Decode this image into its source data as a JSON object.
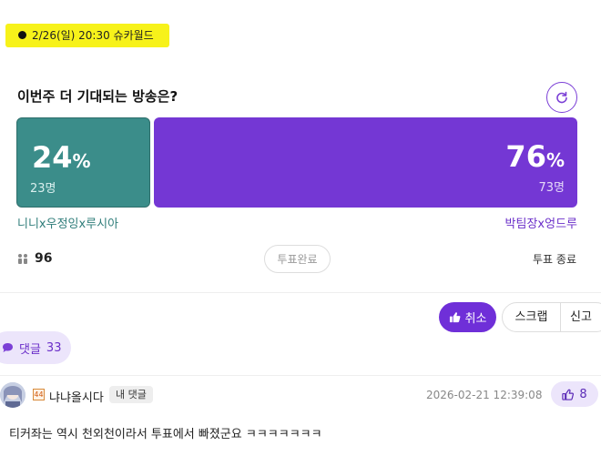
{
  "schedule": {
    "text": "2/26(일) 20:30 슈카월드"
  },
  "poll": {
    "question": "이번주 더 기대되는 방송은?",
    "options": [
      {
        "percent": "24",
        "unit": "%",
        "count": "23명",
        "name": "니니x우정잉x루시아",
        "color": "#3b8d8a"
      },
      {
        "percent": "76",
        "unit": "%",
        "count": "73명",
        "name": "박팀장x엉드루",
        "color": "#7437d4"
      }
    ],
    "voters": "96",
    "vote_done_label": "투표완료",
    "vote_end_label": "투표 종료"
  },
  "actions": {
    "cancel_label": "취소",
    "scrap_label": "스크랩",
    "report_label": "신고"
  },
  "comments": {
    "label": "댓글",
    "count": "33",
    "items": [
      {
        "level": "44",
        "username": "냐냐올시다",
        "badge": "내 댓글",
        "timestamp": "2026-02-21 12:39:08",
        "likes": "8",
        "text": "티커좌는 역시 천외천이라서 투표에서 빠졌군요 ㅋㅋㅋㅋㅋㅋㅋ"
      }
    ]
  },
  "icons": [
    "refresh-icon",
    "voters-icon",
    "thumbs-up-icon",
    "comment-bubble-icon",
    "avatar"
  ]
}
